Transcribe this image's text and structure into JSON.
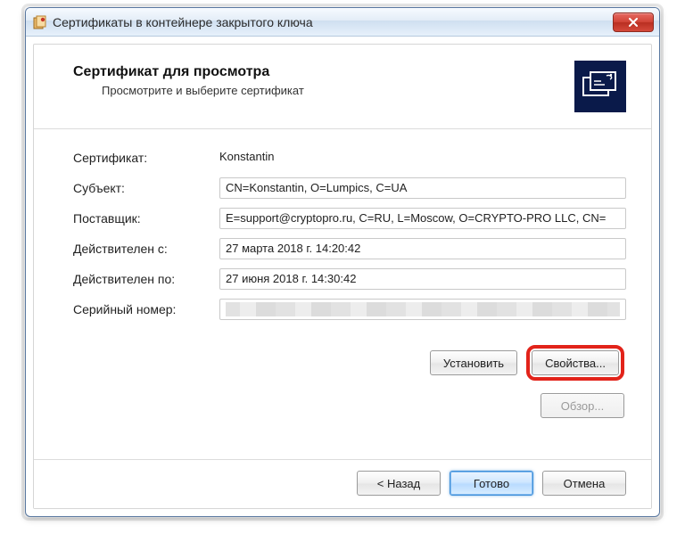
{
  "window": {
    "title": "Сертификаты в контейнере закрытого ключа"
  },
  "header": {
    "title": "Сертификат для просмотра",
    "subtitle": "Просмотрите и выберите сертификат"
  },
  "labels": {
    "certificate": "Сертификат:",
    "subject": "Субъект:",
    "issuer": "Поставщик:",
    "valid_from": "Действителен с:",
    "valid_to": "Действителен по:",
    "serial": "Серийный номер:"
  },
  "values": {
    "certificate": "Konstantin",
    "subject": "CN=Konstantin, O=Lumpics, C=UA",
    "issuer": "E=support@cryptopro.ru, C=RU, L=Moscow, O=CRYPTO-PRO LLC, CN=",
    "valid_from": "27 марта 2018 г. 14:20:42",
    "valid_to": "27 июня 2018 г. 14:30:42"
  },
  "buttons": {
    "install": "Установить",
    "properties": "Свойства...",
    "browse": "Обзор...",
    "back": "< Назад",
    "finish": "Готово",
    "cancel": "Отмена"
  }
}
